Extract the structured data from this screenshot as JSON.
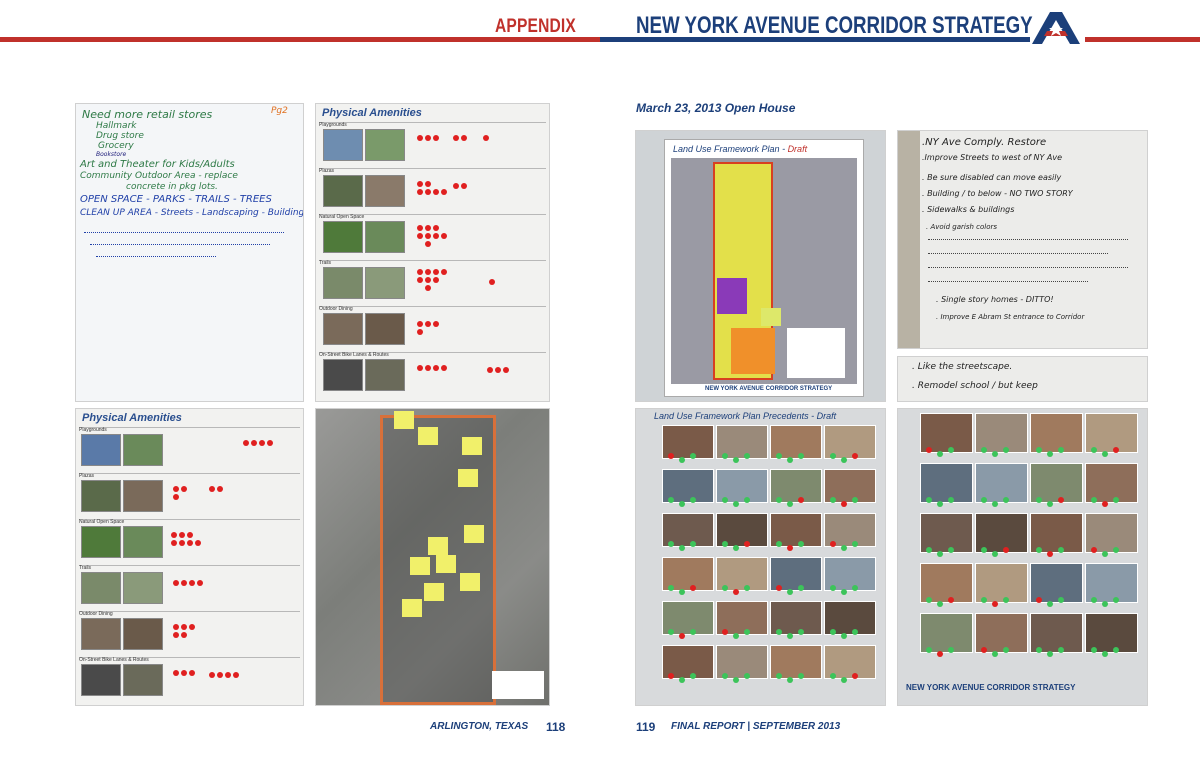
{
  "header": {
    "appendix": "APPENDIX",
    "title": "NEW YORK AVENUE CORRIDOR STRATEGY"
  },
  "subtitle": "March 23, 2013 Open House",
  "footer": {
    "left_label": "ARLINGTON, TEXAS",
    "left_page": "118",
    "right_page": "119",
    "right_label": "FINAL REPORT | SEPTEMBER 2013"
  },
  "photos": {
    "flipchart_left": {
      "lines": [
        "Need more retail stores",
        "Hallmark",
        "Drug store",
        "Grocery",
        "Bookstore",
        "Art and Theater for Kids/Adults",
        "Community Outdoor Area - replace",
        "concrete in pkg lots.",
        "OPEN SPACE - PARKS - TRAILS - TREES",
        "CLEAN UP AREA - Streets - Landscaping - Buildings"
      ],
      "corner_mark": "Pg2"
    },
    "amenities_top": {
      "title": "Physical Amenities",
      "rows": [
        "Playgrounds",
        "Plazas",
        "Natural Open Space",
        "Trails",
        "Outdoor Dining",
        "On-Street Bike Lanes & Routes"
      ]
    },
    "amenities_bottom": {
      "title": "Physical Amenities",
      "rows": [
        "Playgrounds",
        "Plazas",
        "Natural Open Space",
        "Trails",
        "Outdoor Dining",
        "On-Street Bike Lanes & Routes"
      ]
    },
    "land_use_map": {
      "title": "Land Use Framework Plan",
      "draft": "Draft",
      "bottom": "NEW YORK AVENUE CORRIDOR STRATEGY"
    },
    "flipchart_right": {
      "lines": [
        ".NY Ave Comply. Restore",
        ".Improve Streets to west of NY Ave",
        ". Be sure disabled can move easily",
        ". Building / to below - NO TWO STORY",
        ". Sidewalks & buildings",
        ". Avoid garish colors",
        ". Single story homes - DITTO!",
        ". Improve E Abram St entrance to Corridor"
      ]
    },
    "flipchart_small": {
      "lines": [
        ". Like the streetscape.",
        ". Remodel school / but keep"
      ]
    },
    "precedents_left": {
      "title": "Land Use Framework Plan Precedents - Draft"
    },
    "precedents_right": {
      "banner": "NEW YORK AVENUE CORRIDOR STRATEGY"
    }
  },
  "colors": {
    "red": "#c0312b",
    "navy": "#1c3f7a"
  }
}
